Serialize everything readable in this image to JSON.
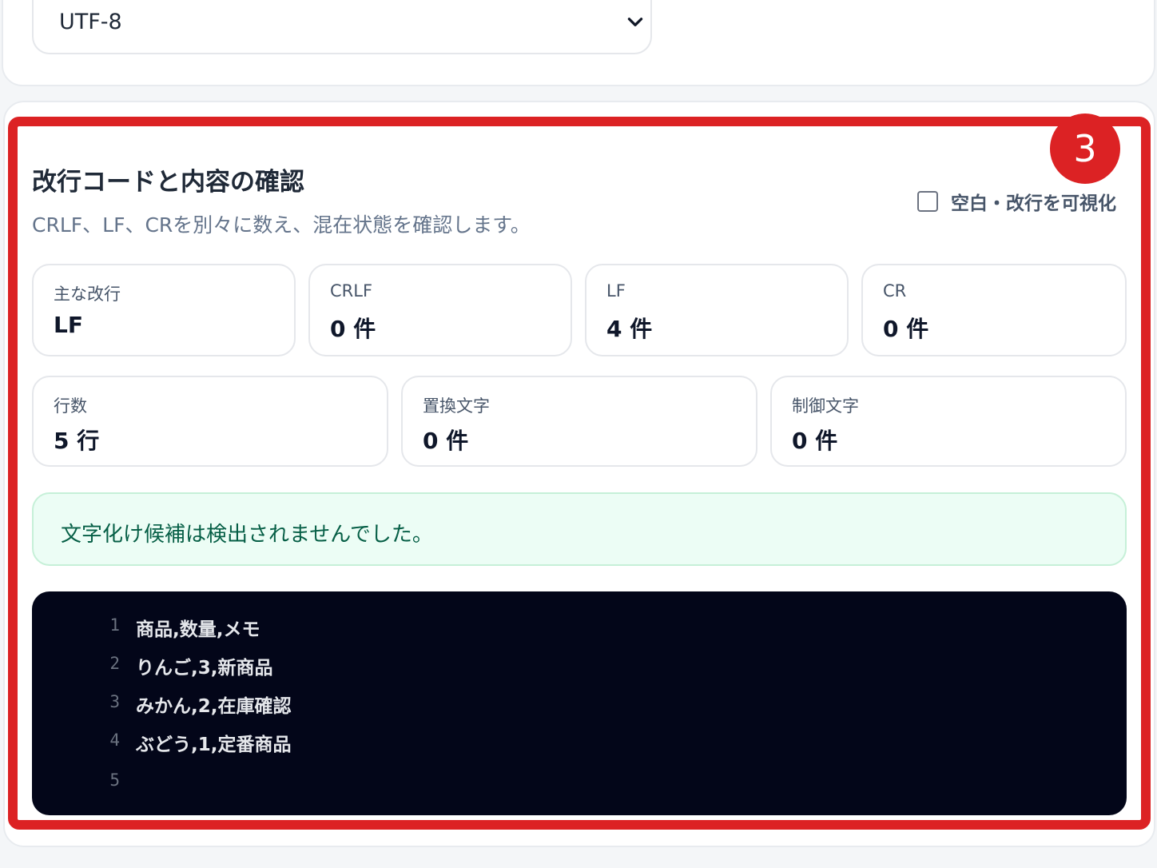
{
  "encoding": {
    "selected": "UTF-8"
  },
  "badge": {
    "number": "3"
  },
  "section": {
    "title": "改行コードと内容の確認",
    "subtitle": "CRLF、LF、CRを別々に数え、混在状態を確認します。",
    "toggle_label": "空白・改行を可視化",
    "toggle_checked": false
  },
  "stats_row1": [
    {
      "label": "主な改行",
      "value": "LF"
    },
    {
      "label": "CRLF",
      "value": "0 件"
    },
    {
      "label": "LF",
      "value": "4 件"
    },
    {
      "label": "CR",
      "value": "0 件"
    }
  ],
  "stats_row2": [
    {
      "label": "行数",
      "value": "5 行"
    },
    {
      "label": "置換文字",
      "value": "0 件"
    },
    {
      "label": "制御文字",
      "value": "0 件"
    }
  ],
  "notice": {
    "text": "文字化け候補は検出されませんでした。"
  },
  "code_lines": [
    {
      "no": "1",
      "text": "商品,数量,メモ"
    },
    {
      "no": "2",
      "text": "りんご,3,新商品"
    },
    {
      "no": "3",
      "text": "みかん,2,在庫確認"
    },
    {
      "no": "4",
      "text": "ぶどう,1,定番商品"
    },
    {
      "no": "5",
      "text": ""
    }
  ],
  "colors": {
    "highlight": "#dc2224",
    "notice_bg": "#ecfdf5",
    "code_bg": "#030619"
  },
  "icons": {
    "select": "chevron-down-icon",
    "toggle": "checkbox"
  }
}
